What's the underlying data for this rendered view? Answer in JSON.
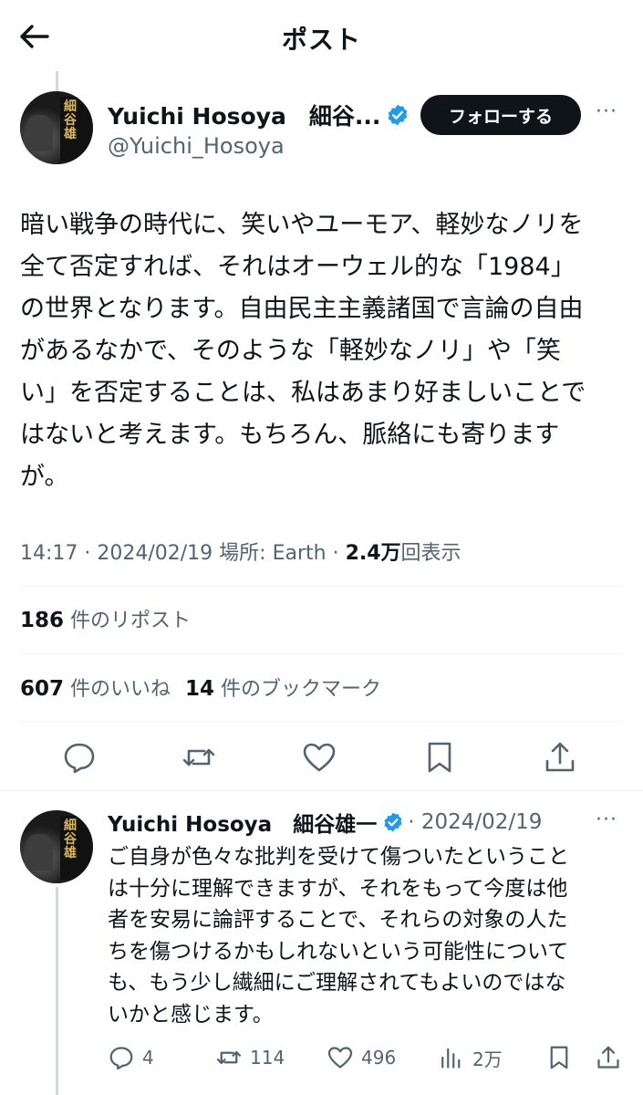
{
  "header": {
    "title": "ポスト",
    "back_icon": "arrow-left-icon"
  },
  "colors": {
    "text": "#0f1419",
    "secondary": "#536471",
    "verified": "#1d9bf0",
    "follow_bg": "#0f1419",
    "divider": "#eff3f4"
  },
  "post": {
    "author": {
      "name": "Yuichi Hosoya　細谷...",
      "handle": "@Yuichi_Hosoya",
      "verified": true
    },
    "follow_label": "フォローする",
    "more_label": "···",
    "text": "暗い戦争の時代に、笑いやユーモア、軽妙なノリを\n全て否定すれば、それはオーウェル的な「1984」\nの世界となります。自由民主主義諸国で言論の自由\nがあるなかで、そのような「軽妙なノリ」や「笑\nい」を否定することは、私はあまり好ましいことで\nはないと考えます。もちろん、脈絡にも寄ります\nが。",
    "meta_prefix": "14:17 · 2024/02/19 場所: Earth · ",
    "views_count": "2.4万",
    "views_label": "回表示",
    "reposts_count": "186",
    "reposts_label": "件のリポスト",
    "likes_count": "607",
    "likes_label": "件のいいね",
    "bookmarks_count": "14",
    "bookmarks_label": "件のブックマーク",
    "actions": [
      "reply-icon",
      "repost-icon",
      "like-icon",
      "bookmark-icon",
      "share-icon"
    ]
  },
  "reply": {
    "author": {
      "name": "Yuichi Hosoya　細谷雄一",
      "verified": true
    },
    "date": "· 2024/02/19",
    "more_label": "···",
    "text": "ご自身が色々な批判を受けて傷ついたということ\nは十分に理解できますが、それをもって今度は他\n者を安易に論評することで、それらの対象の人た\nちを傷つけるかもしれないという可能性について\nも、もう少し繊細にご理解されてもよいのではな\nいかと感じます。",
    "replies": "4",
    "reposts": "114",
    "likes": "496",
    "views": "2万"
  }
}
